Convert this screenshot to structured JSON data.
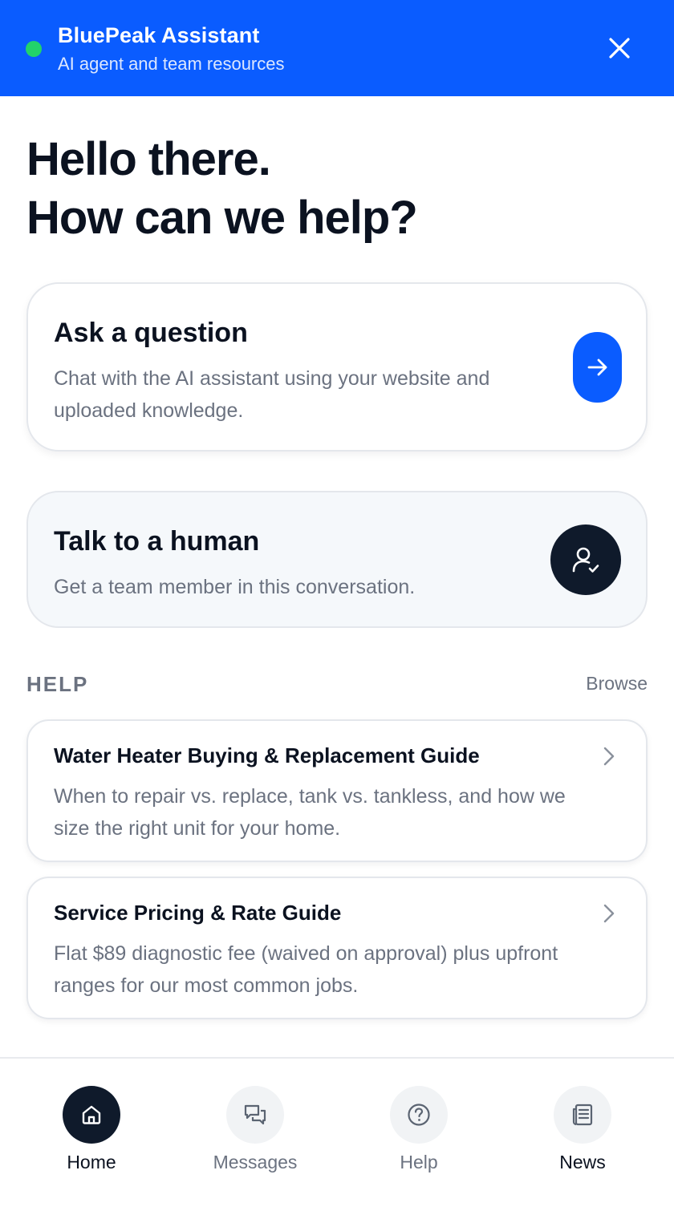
{
  "header": {
    "title": "BluePeak Assistant",
    "subtitle": "AI agent and team resources",
    "status_color": "#22d36b",
    "brand_color": "#0a5cff",
    "close_icon": "close-icon"
  },
  "greeting": {
    "line1": "Hello there.",
    "line2": "How can we help?"
  },
  "ask_card": {
    "title": "Ask a question",
    "description": "Chat with the AI assistant using your website and uploaded knowledge.",
    "icon": "arrow-right-icon"
  },
  "human_card": {
    "title": "Talk to a human",
    "description": "Get a team member in this conversation.",
    "icon": "user-check-icon"
  },
  "help_section": {
    "title": "HELP",
    "browse_label": "Browse",
    "articles": [
      {
        "title": "Water Heater Buying & Replacement Guide",
        "description": "When to repair vs. replace, tank vs. tankless, and how we size the right unit for your home."
      },
      {
        "title": "Service Pricing & Rate Guide",
        "description": "Flat $89 diagnostic fee (waived on approval) plus upfront ranges for our most common jobs."
      }
    ]
  },
  "bottom_nav": {
    "items": [
      {
        "label": "Home",
        "icon": "home-icon",
        "active": true
      },
      {
        "label": "Messages",
        "icon": "messages-icon",
        "active": false
      },
      {
        "label": "Help",
        "icon": "help-circle-icon",
        "active": false
      },
      {
        "label": "News",
        "icon": "news-icon",
        "active": false
      }
    ]
  }
}
